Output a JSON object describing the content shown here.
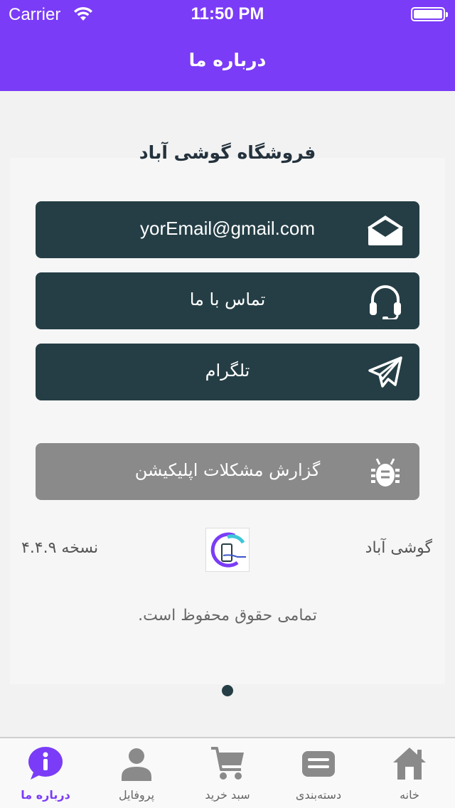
{
  "status_bar": {
    "carrier": "Carrier",
    "time": "11:50 PM"
  },
  "nav": {
    "title": "درباره ما"
  },
  "store": {
    "title": "فروشگاه گوشی آباد"
  },
  "buttons": {
    "email": {
      "label": "yorEmail@gmail.com",
      "icon": "envelope-open-icon"
    },
    "contact": {
      "label": "تماس با ما",
      "icon": "headset-icon"
    },
    "telegram": {
      "label": "تلگرام",
      "icon": "paper-plane-icon"
    },
    "report": {
      "label": "گزارش مشکلات اپلیکیشن",
      "icon": "bug-icon"
    }
  },
  "footer": {
    "app_name": "گوشی آباد",
    "version": "نسخه ۴.۴.۹",
    "copyright": "تمامی حقوق محفوظ است."
  },
  "tabs": [
    {
      "label": "درباره ما",
      "icon": "info-icon",
      "active": true
    },
    {
      "label": "پروفایل",
      "icon": "user-icon",
      "active": false
    },
    {
      "label": "سبد خرید",
      "icon": "cart-icon",
      "active": false
    },
    {
      "label": "دسته‌بندی",
      "icon": "category-icon",
      "active": false
    },
    {
      "label": "خانه",
      "icon": "home-icon",
      "active": false
    }
  ],
  "colors": {
    "accent": "#7a3cf7",
    "button_dark": "#253e46",
    "button_gray": "#8a8a8a",
    "tab_inactive": "#8a8a8a"
  }
}
